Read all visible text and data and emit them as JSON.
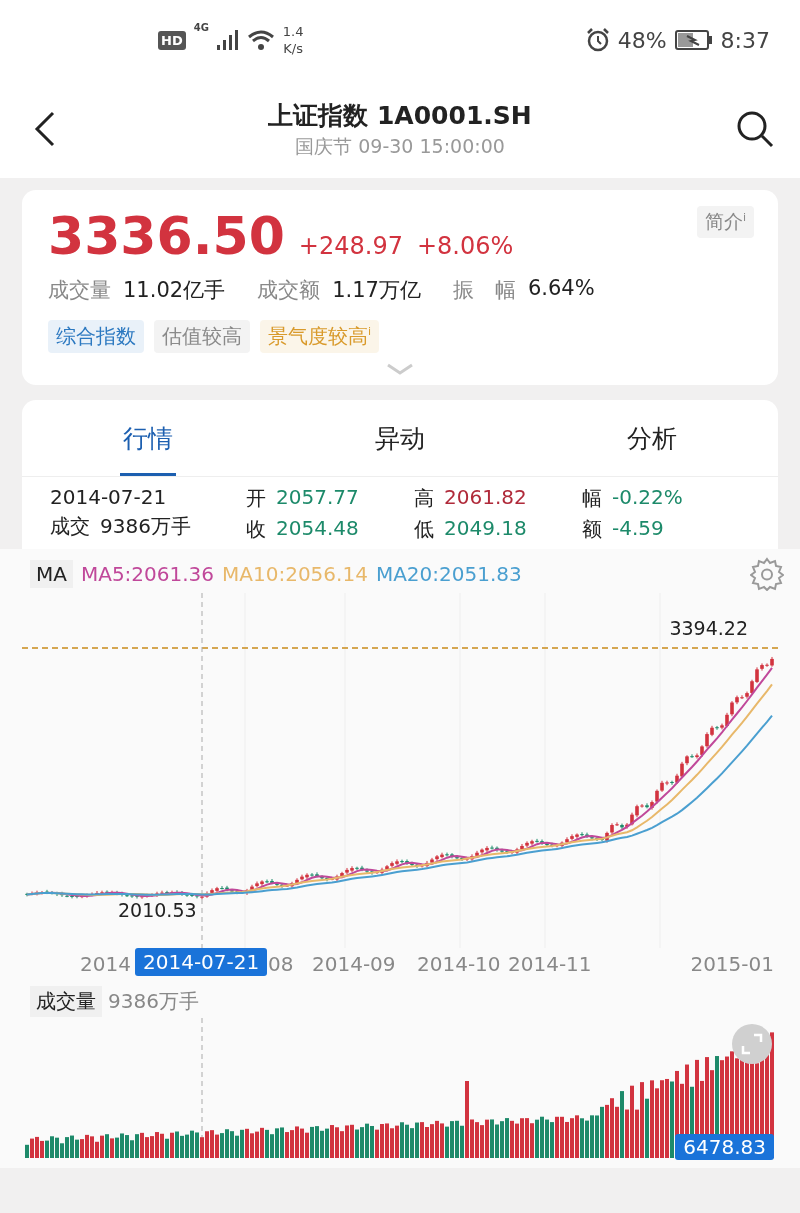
{
  "status_bar": {
    "hd": "HD",
    "network": "4G",
    "speed": "1.4",
    "speed_unit": "K/s",
    "battery": "48%",
    "time": "8:37"
  },
  "header": {
    "title": "上证指数 1A0001.SH",
    "subtitle": "国庆节 09-30 15:00:00"
  },
  "quote": {
    "price": "3336.50",
    "change": "+248.97",
    "change_pct": "+8.06%",
    "intro_button": "简介$^{i}$",
    "stats": [
      {
        "label": "成交量",
        "value": "11.02亿手"
      },
      {
        "label": "成交额",
        "value": "1.17万亿"
      },
      {
        "label": "振　幅",
        "value": "6.64%"
      }
    ],
    "tags": [
      {
        "text": "综合指数",
        "color": "#2b78c0"
      },
      {
        "text": "估值较高",
        "color": "#8a8a8a"
      },
      {
        "text": "景气度较高$^{i}$",
        "color": "#d99a2b"
      }
    ]
  },
  "tabs": [
    {
      "label": "行情",
      "selected": true
    },
    {
      "label": "异动",
      "selected": false
    },
    {
      "label": "分析",
      "selected": false
    }
  ],
  "detail": {
    "date": "2014-07-21",
    "volume_label": "成交",
    "volume": "9386万手",
    "fields": [
      {
        "label": "开",
        "value": "2057.77",
        "color": "#1d8a6a"
      },
      {
        "label": "高",
        "value": "2061.82",
        "color": "#b02a3a"
      },
      {
        "label": "幅",
        "value": "-0.22%",
        "color": "#1d8a6a"
      },
      {
        "label": "收",
        "value": "2054.48",
        "color": "#1d8a6a"
      },
      {
        "label": "低",
        "value": "2049.18",
        "color": "#1d8a6a"
      },
      {
        "label": "额",
        "value": "-4.59",
        "color": "#1d8a6a"
      }
    ]
  },
  "ma": {
    "selector": "MA",
    "values": [
      {
        "text": "MA5:2061.36",
        "color": "#c0489a"
      },
      {
        "text": "MA10:2056.14",
        "color": "#e8b86a"
      },
      {
        "text": "MA20:2051.83",
        "color": "#4a9fd0"
      }
    ]
  },
  "price_chart": {
    "high_label": "3394.22",
    "low_label": "2010.53",
    "dates": [
      "2014",
      "08",
      "2014-09",
      "2014-10",
      "2014-11",
      "2015-01"
    ],
    "crosshair_date": "2014-07-21"
  },
  "volume": {
    "selector": "成交量",
    "value": "9386万手",
    "last_label": "6478.83"
  }
}
